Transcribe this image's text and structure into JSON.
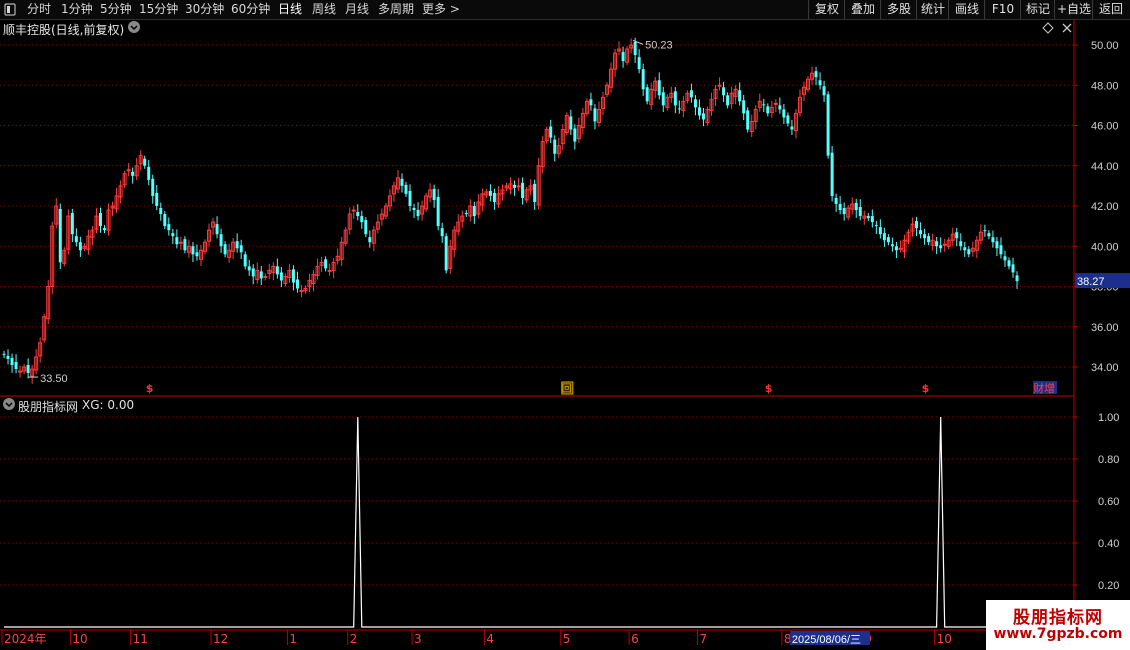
{
  "toolbar": {
    "menu_icon": "window-icon",
    "periods": [
      "分时",
      "1分钟",
      "5分钟",
      "15分钟",
      "30分钟",
      "60分钟",
      "日线",
      "周线",
      "月线",
      "多周期",
      "更多 >"
    ],
    "active_period": "日线",
    "right_buttons": [
      "复权",
      "叠加",
      "多股",
      "统计",
      "画线",
      "F10",
      "标记",
      "+自选",
      "返回"
    ]
  },
  "main_chart": {
    "title": "顺丰控股(日线,前复权)",
    "last_price": "38.27",
    "high_label": "50.23",
    "low_label": "33.50",
    "markers": [
      {
        "idx": 36,
        "text": "$"
      },
      {
        "idx": 140,
        "text": "回"
      },
      {
        "idx": 190,
        "text": "$"
      },
      {
        "idx": 229,
        "text": "$"
      },
      {
        "idx": 257,
        "text": "财增"
      }
    ],
    "colors": {
      "up": "#ff3c3c",
      "down": "#54ffff",
      "grid": "#800000",
      "axis": "#c00000",
      "price_tag_bg": "#1c2f8c"
    }
  },
  "indicator": {
    "title": "股朋指标网",
    "value_label": "XG: 0.00",
    "signal_indices": [
      88,
      233
    ]
  },
  "x_axis": {
    "date_labels": [
      "2024年",
      "10",
      "11",
      "12",
      "1",
      "2",
      "3",
      "4",
      "5",
      "6",
      "7",
      "8",
      "9",
      "10"
    ],
    "cursor_date": "2025/08/06/三"
  },
  "logo": {
    "line1": "股朋指标网",
    "line2": "www.7gpzb.com"
  },
  "chart_data": {
    "type": "candlestick",
    "title": "顺丰控股(日线,前复权)",
    "y_ticks": [
      50.0,
      48.0,
      46.0,
      44.0,
      42.0,
      40.0,
      38.0,
      36.0,
      34.0
    ],
    "ylim": [
      33.0,
      50.6
    ],
    "annotations": {
      "high": 50.23,
      "low": 33.5,
      "last": 38.27
    },
    "closes": [
      34.6,
      34.4,
      34.1,
      33.9,
      33.8,
      34.0,
      33.7,
      33.9,
      34.5,
      35.2,
      36.5,
      38.0,
      41.0,
      42.0,
      39.2,
      39.8,
      41.5,
      40.6,
      40.2,
      39.8,
      40.0,
      40.5,
      40.8,
      41.5,
      41.0,
      40.8,
      41.8,
      42.0,
      42.5,
      43.0,
      43.6,
      43.8,
      43.5,
      44.0,
      44.5,
      44.0,
      43.3,
      42.5,
      42.0,
      41.6,
      41.0,
      40.8,
      40.5,
      40.1,
      40.2,
      39.8,
      40.0,
      39.6,
      39.5,
      39.8,
      40.2,
      40.8,
      41.2,
      40.6,
      40.0,
      39.6,
      39.8,
      40.2,
      39.9,
      39.7,
      39.0,
      38.8,
      38.5,
      38.8,
      38.4,
      38.5,
      38.8,
      39.0,
      38.6,
      38.3,
      38.5,
      38.8,
      38.2,
      37.9,
      37.8,
      37.9,
      38.3,
      38.6,
      39.0,
      39.2,
      38.9,
      38.8,
      39.2,
      39.5,
      40.2,
      40.8,
      41.6,
      41.8,
      41.5,
      41.2,
      40.6,
      40.2,
      40.8,
      41.2,
      41.6,
      42.0,
      42.5,
      43.0,
      43.4,
      43.0,
      42.6,
      42.0,
      41.8,
      41.5,
      42.0,
      42.5,
      42.8,
      42.3,
      41.0,
      40.5,
      38.8,
      40.0,
      40.8,
      41.2,
      41.5,
      41.6,
      42.0,
      41.5,
      42.2,
      42.6,
      42.7,
      42.5,
      42.2,
      42.6,
      42.8,
      43.0,
      43.1,
      42.9,
      43.0,
      42.4,
      42.8,
      43.0,
      42.2,
      44.0,
      45.2,
      45.8,
      45.4,
      44.6,
      45.0,
      45.8,
      46.5,
      45.8,
      45.2,
      46.0,
      46.6,
      47.2,
      47.0,
      46.2,
      46.8,
      47.4,
      48.0,
      48.8,
      49.6,
      49.8,
      49.2,
      49.8,
      50.0,
      49.5,
      48.8,
      47.8,
      47.2,
      47.8,
      48.2,
      47.5,
      47.0,
      47.4,
      47.6,
      47.0,
      46.8,
      47.2,
      47.6,
      47.4,
      46.9,
      46.5,
      46.3,
      46.8,
      47.3,
      47.8,
      48.0,
      47.5,
      47.0,
      47.6,
      47.8,
      47.2,
      46.6,
      45.8,
      46.2,
      46.8,
      47.2,
      47.0,
      46.6,
      46.9,
      47.1,
      46.8,
      46.4,
      46.1,
      45.8,
      46.6,
      47.4,
      47.9,
      48.3,
      48.6,
      48.4,
      48.0,
      47.5,
      44.5,
      42.5,
      42.1,
      41.8,
      41.6,
      41.9,
      42.1,
      41.8,
      41.5,
      41.5,
      41.4,
      41.2,
      41.0,
      40.6,
      40.3,
      40.2,
      40.0,
      39.8,
      39.9,
      40.3,
      40.7,
      41.1,
      40.9,
      40.6,
      40.4,
      40.2,
      40.3,
      40.0,
      39.9,
      40.1,
      40.3,
      40.6,
      40.4,
      40.0,
      39.8,
      39.6,
      39.9,
      40.3,
      40.7,
      40.8,
      40.5,
      40.2,
      39.9,
      39.6,
      39.3,
      39.0,
      38.7,
      38.27
    ],
    "xg": {
      "type": "line",
      "ylim": [
        0,
        1.08
      ],
      "y_ticks": [
        1.0,
        0.8,
        0.6,
        0.4,
        0.2
      ],
      "signal_indices": [
        88,
        233
      ],
      "signal_value": 1.0,
      "base_value": 0.0
    },
    "x_axis_labels": [
      "2024年",
      "10",
      "11",
      "12",
      "1",
      "2",
      "3",
      "4",
      "5",
      "6",
      "7",
      "8",
      "9",
      "10"
    ],
    "grid": true
  }
}
